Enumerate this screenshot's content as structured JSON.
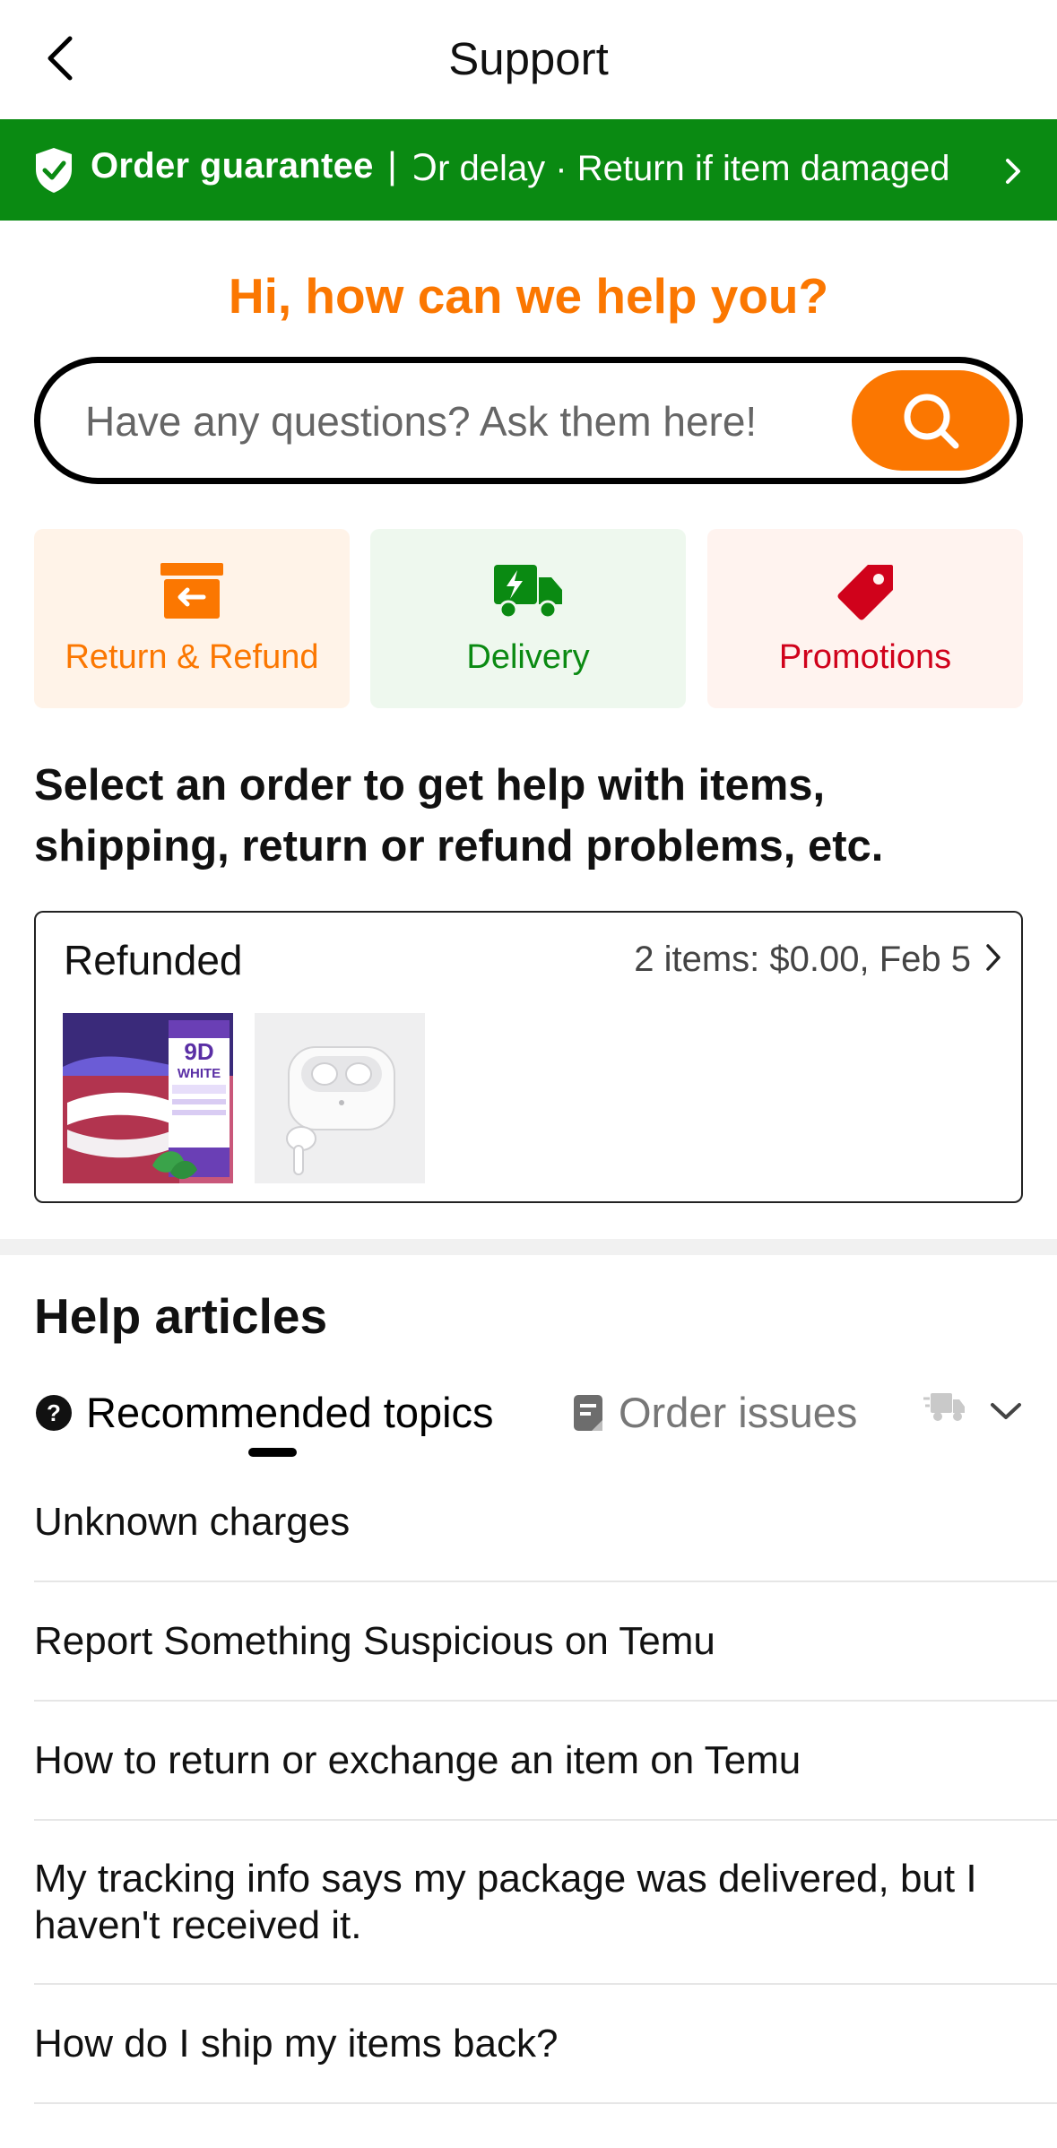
{
  "header": {
    "title": "Support"
  },
  "banner": {
    "title": "Order guarantee",
    "separator": "|",
    "message": "Ↄr delay · Return if item damaged"
  },
  "greeting": "Hi, how can we help you?",
  "search": {
    "placeholder": "Have any questions? Ask them here!"
  },
  "categories": [
    {
      "label": "Return & Refund",
      "icon": "box-return-icon",
      "color": "#fb7701"
    },
    {
      "label": "Delivery",
      "icon": "truck-icon",
      "color": "#0a8a12"
    },
    {
      "label": "Promotions",
      "icon": "tag-icon",
      "color": "#d0021b"
    }
  ],
  "order_section": {
    "heading": "Select an order to get help with items, shipping, return or refund problems, etc.",
    "order": {
      "status": "Refunded",
      "summary": "2 items:  $0.00, Feb 5",
      "items": [
        {
          "name": "toothpaste",
          "label_top": "9D",
          "label_bottom": "WHITE"
        },
        {
          "name": "earbuds"
        }
      ]
    }
  },
  "help": {
    "heading": "Help articles",
    "tabs": [
      {
        "label": "Recommended topics",
        "icon": "question-icon",
        "active": true
      },
      {
        "label": "Order issues",
        "icon": "document-icon",
        "active": false
      },
      {
        "label": "",
        "icon": "truck-fast-icon",
        "active": false
      }
    ],
    "articles": [
      "Unknown charges",
      "Report Something Suspicious on Temu",
      "How to return or exchange an item on Temu",
      "My tracking info says my package was delivered, but I haven't received it.",
      "How do I ship my items back?"
    ]
  },
  "colors": {
    "brand_orange": "#fb7701",
    "guarantee_green": "#0a8a12",
    "promo_red": "#d0021b"
  }
}
